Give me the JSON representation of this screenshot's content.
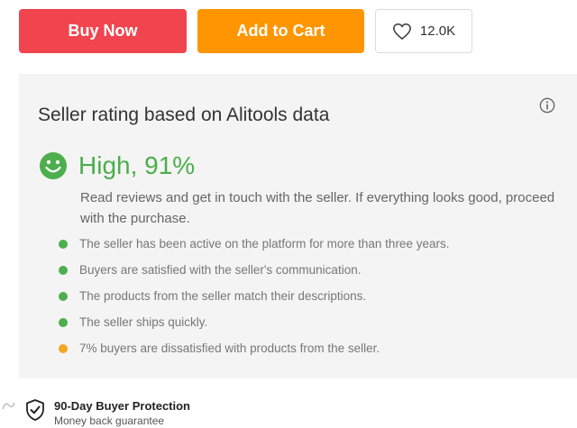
{
  "buttons": {
    "buy_now": "Buy Now",
    "add_to_cart": "Add to Cart",
    "wishlist_count": "12.0K"
  },
  "rating_panel": {
    "title": "Seller rating based on Alitools data",
    "rating": "High, 91%",
    "description": "Read reviews and get in touch with the seller. If everything looks good, proceed with the purchase.",
    "facts": [
      {
        "text": "The seller has been active on the platform for more than three years.",
        "status": "positive"
      },
      {
        "text": "Buyers are satisfied with the seller's communication.",
        "status": "positive"
      },
      {
        "text": "The products from the seller match their descriptions.",
        "status": "positive"
      },
      {
        "text": "The seller ships quickly.",
        "status": "positive"
      },
      {
        "text": "7% buyers are dissatisfied with products from the seller.",
        "status": "warning"
      }
    ]
  },
  "protection": {
    "title": "90-Day Buyer Protection",
    "subtitle": "Money back guarantee"
  },
  "icons": {
    "heart": "heart-icon",
    "info": "info-icon",
    "smile": "smile-icon",
    "shield": "shield-check-icon"
  },
  "colors": {
    "buy_now": "#f0454f",
    "add_to_cart": "#ff9500",
    "positive": "#4cae4c",
    "warning": "#f5a623",
    "panel_bg": "#f4f4f4"
  }
}
